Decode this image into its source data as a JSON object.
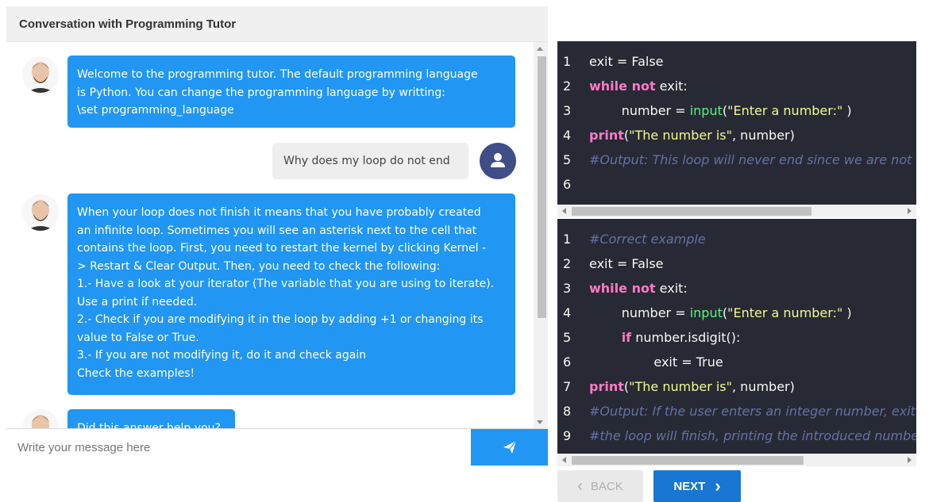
{
  "chat": {
    "title": "Conversation with Programming Tutor",
    "messages": [
      {
        "sender": "tutor",
        "lines": [
          "Welcome to the programming tutor. The default programming language",
          "is Python. You can change the programming language by writting:",
          "\\set programming_language"
        ]
      },
      {
        "sender": "user",
        "text": "Why does my loop do not end"
      },
      {
        "sender": "tutor",
        "lines": [
          "When your loop does not finish it means that you have probably created",
          "an infinite loop. Sometimes you will see an asterisk next to the cell that",
          "contains the loop. First, you need to restart the kernel by clicking Kernel -",
          "> Restart & Clear Output. Then, you need to check the following:",
          "1.- Have a look at your iterator (The variable that you are using to iterate).",
          "Use a print if needed.",
          "2.- Check if you are modifying it in the loop by adding +1 or changing its",
          "value to False or True.",
          "3.- If you are not modifying it, do it and check again",
          "Check the examples!"
        ]
      },
      {
        "sender": "tutor",
        "lines": [
          "Did this answer help you?"
        ]
      }
    ],
    "input": {
      "placeholder": "Write your message here",
      "value": ""
    },
    "send_icon": "send-icon"
  },
  "code_panels": [
    {
      "lines": [
        {
          "n": "1",
          "html": "exit = False"
        },
        {
          "n": "2",
          "html": "<span class=\"kw\">while not</span> exit:"
        },
        {
          "n": "3",
          "html": "&nbsp;&nbsp;&nbsp;&nbsp;&nbsp;&nbsp;&nbsp;&nbsp;number = <span class=\"fn\">input</span>(<span class=\"str\">\"Enter a number:\"</span> )"
        },
        {
          "n": "4",
          "html": "<span class=\"kw\">print</span>(<span class=\"str\">\"The number is\"</span>, number)"
        },
        {
          "n": "5",
          "html": "<span class=\"cm\">#Output: This loop will never end since we are not c</span>"
        },
        {
          "n": "6",
          "html": ""
        }
      ]
    },
    {
      "lines": [
        {
          "n": "1",
          "html": "<span class=\"cm\">#Correct example</span>"
        },
        {
          "n": "2",
          "html": "exit = False"
        },
        {
          "n": "3",
          "html": "<span class=\"kw\">while not</span> exit:"
        },
        {
          "n": "4",
          "html": "&nbsp;&nbsp;&nbsp;&nbsp;&nbsp;&nbsp;&nbsp;&nbsp;number = <span class=\"fn\">input</span>(<span class=\"str\">\"Enter a number:\"</span> )"
        },
        {
          "n": "5",
          "html": "&nbsp;&nbsp;&nbsp;&nbsp;&nbsp;&nbsp;&nbsp;&nbsp;<span class=\"kw\">if</span> number.isdigit():"
        },
        {
          "n": "6",
          "html": "&nbsp;&nbsp;&nbsp;&nbsp;&nbsp;&nbsp;&nbsp;&nbsp;&nbsp;&nbsp;&nbsp;&nbsp;&nbsp;&nbsp;&nbsp;&nbsp;exit = True"
        },
        {
          "n": "7",
          "html": "<span class=\"kw\">print</span>(<span class=\"str\">\"The number is\"</span>, number)"
        },
        {
          "n": "8",
          "html": "<span class=\"cm\">#Output: If the user enters an integer number, exit w</span>"
        },
        {
          "n": "9",
          "html": "<span class=\"cm\">#the loop will finish, printing the introduced numbe</span>"
        }
      ]
    }
  ],
  "nav": {
    "back_label": "BACK",
    "next_label": "NEXT"
  },
  "colors": {
    "accent": "#2196f3",
    "next": "#1976d2",
    "code_bg": "#272935",
    "user_avatar": "#3f4e86"
  }
}
